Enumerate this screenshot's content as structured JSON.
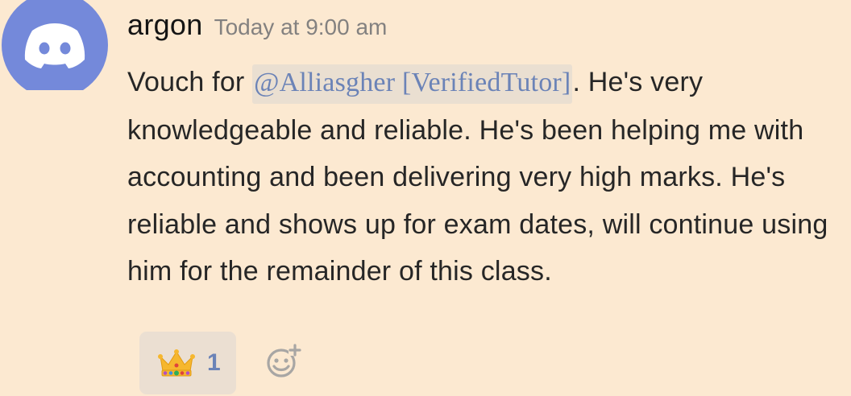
{
  "message": {
    "author": "argon",
    "timestamp": "Today at 9:00 am",
    "text_before_mention": "Vouch for ",
    "mention": "@Alliasgher [VerifiedTutor]",
    "text_after_mention": ". He's very knowledgeable and reliable. He's been helping me with accounting and been delivering very high marks. He's reliable and shows up for exam dates, will continue using him for the remainder of this class."
  },
  "reactions": [
    {
      "emoji": "crown-icon",
      "count": "1"
    }
  ],
  "colors": {
    "background": "#fce9d1",
    "avatar_blue": "#7489da",
    "mention_text": "#6b83b7",
    "mention_bg": "#eadfd1",
    "reaction_bg": "#ebdfd2",
    "timestamp": "#838180"
  }
}
